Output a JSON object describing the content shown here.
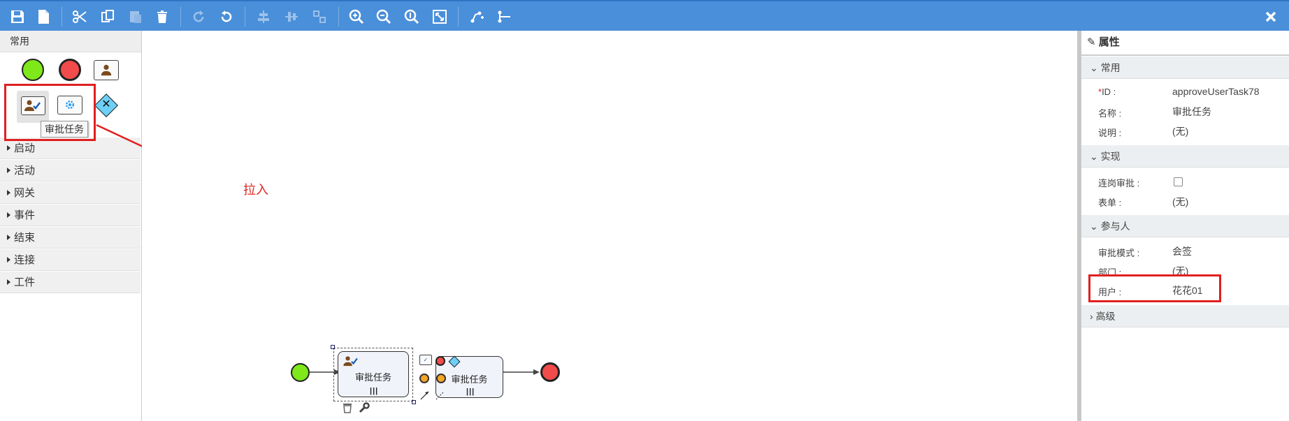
{
  "toolbar": {
    "buttons": [
      "save-icon",
      "new-file-icon",
      "cut-icon",
      "copy-icon",
      "paste-icon",
      "delete-icon",
      "redo-icon",
      "undo-icon",
      "align-horizontal-icon",
      "align-vertical-icon",
      "same-size-icon",
      "zoom-in-icon",
      "zoom-out-icon",
      "zoom-actual-icon",
      "fit-icon",
      "bend-add-icon",
      "bend-remove-icon"
    ],
    "close_icon": "close-icon"
  },
  "palette": {
    "header": "常用",
    "tooltip": "审批任务",
    "categories": [
      {
        "label": "启动"
      },
      {
        "label": "活动"
      },
      {
        "label": "网关"
      },
      {
        "label": "事件"
      },
      {
        "label": "结束"
      },
      {
        "label": "连接"
      },
      {
        "label": "工件"
      }
    ]
  },
  "canvas": {
    "drag_hint": "拉入",
    "task1_label": "审批任务",
    "task2_label": "审批任务"
  },
  "properties": {
    "title": "属性",
    "sections": {
      "common": "常用",
      "implementation": "实现",
      "participants": "参与人",
      "advanced": "高级"
    },
    "fields": {
      "id_required_mark": "*",
      "id_label": "ID :",
      "id_value": "approveUserTask78",
      "name_label": "名称 :",
      "name_value": "审批任务",
      "desc_label": "说明 :",
      "desc_value": "(无)",
      "consecutive_label": "连岗审批 :",
      "form_label": "表单 :",
      "form_value": "(无)",
      "mode_label": "审批模式 :",
      "mode_value": "会签",
      "dept_label": "部门 :",
      "dept_value": "(无)",
      "user_label": "用户 :",
      "user_value": "花花01"
    }
  },
  "colors": {
    "toolbar": "#4a8fd9",
    "highlight": "#e02020",
    "start": "#7ee81a",
    "end": "#f24b4b"
  }
}
